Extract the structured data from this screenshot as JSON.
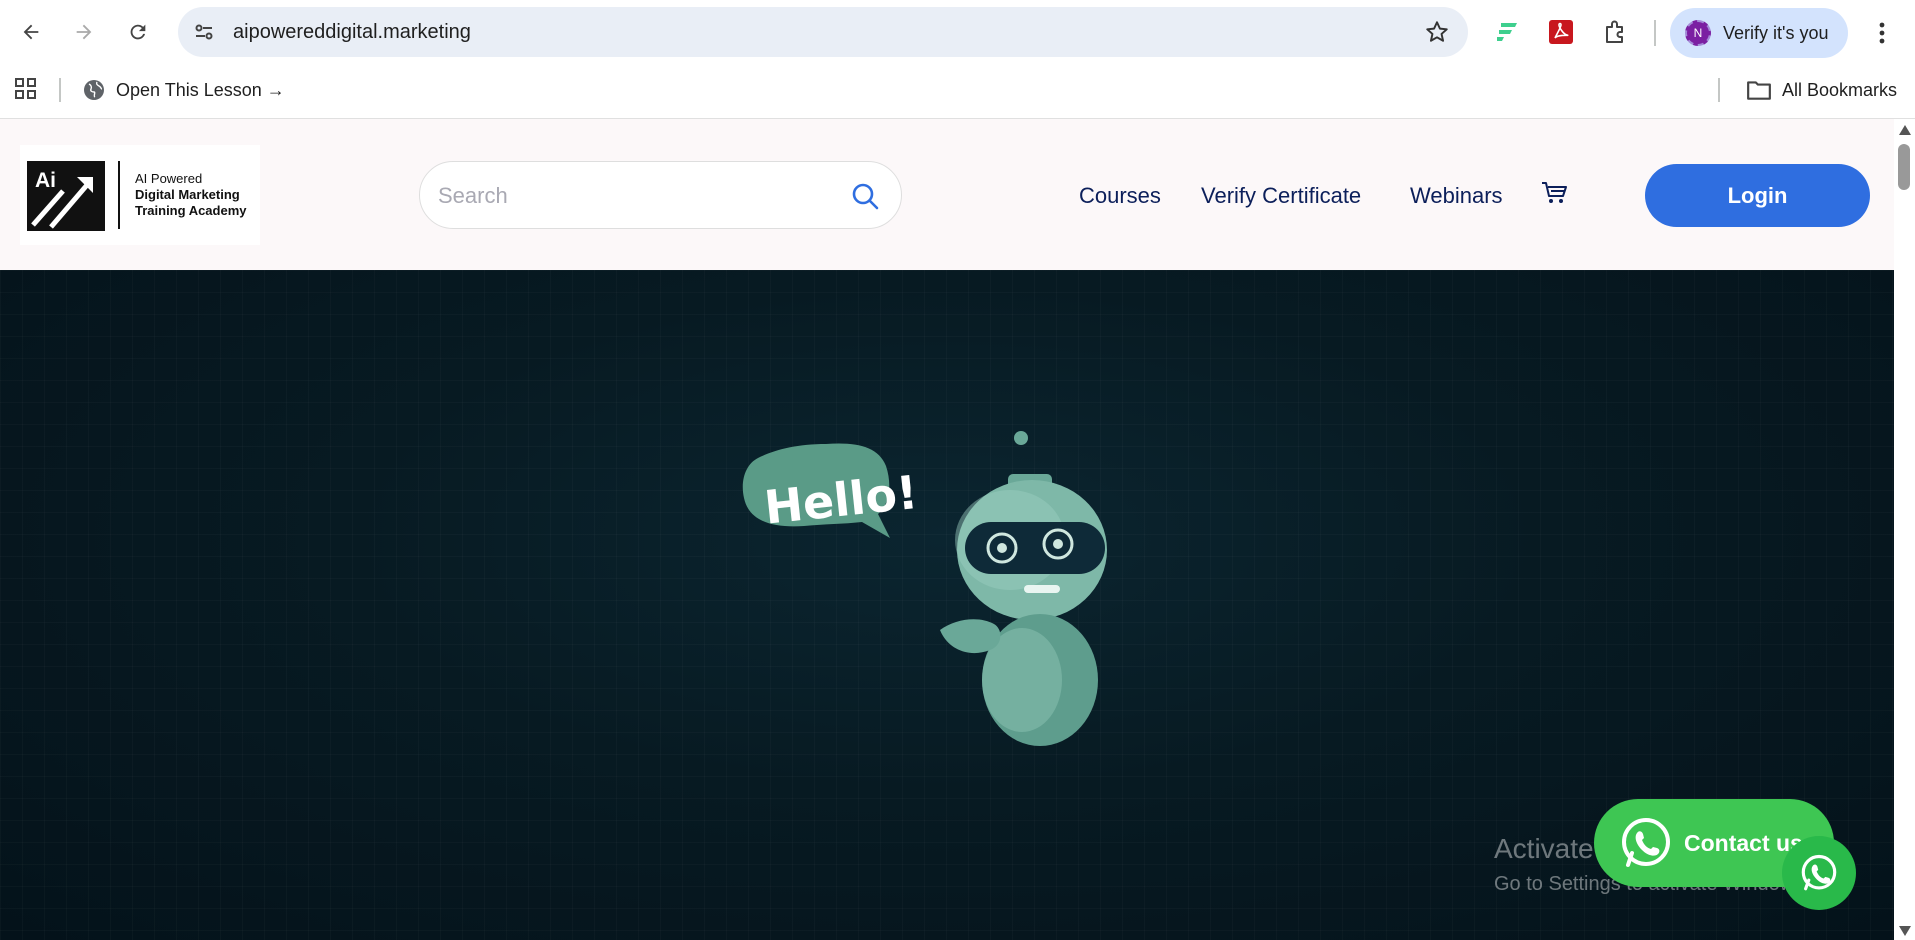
{
  "browser": {
    "url": "aipowereddigital.marketing",
    "profile_initial": "N",
    "profile_label": "Verify it's you",
    "icons": {
      "back": "back-arrow-icon",
      "forward": "forward-arrow-icon",
      "reload": "reload-icon",
      "site_info": "site-settings-icon",
      "bookmark_star": "star-icon",
      "extensions": "puzzle-icon",
      "menu": "kebab-menu-icon"
    }
  },
  "bookmarks_bar": {
    "items": [
      {
        "label": "Open This Lesson →",
        "icon": "globe-icon"
      }
    ],
    "all_bookmarks_label": "All Bookmarks"
  },
  "site": {
    "logo": {
      "mark_text": "Ai",
      "line1": "AI Powered",
      "line2": "Digital Marketing",
      "line3": "Training Academy"
    },
    "search": {
      "placeholder": "Search"
    },
    "menu": {
      "courses": "Courses",
      "verify": "Verify Certificate",
      "webinars": "Webinars"
    },
    "login_label": "Login",
    "hero": {
      "bubble_text": "Hello!"
    },
    "contact_label": "Contact us"
  },
  "os_overlay": {
    "line1": "Activate Windows",
    "line2": "Go to Settings to activate Windows."
  },
  "colors": {
    "login_bg": "#2f6ee0",
    "nav_text": "#0c1f5a",
    "whatsapp_green": "#3ec653",
    "hero_bg": "#071a22"
  }
}
